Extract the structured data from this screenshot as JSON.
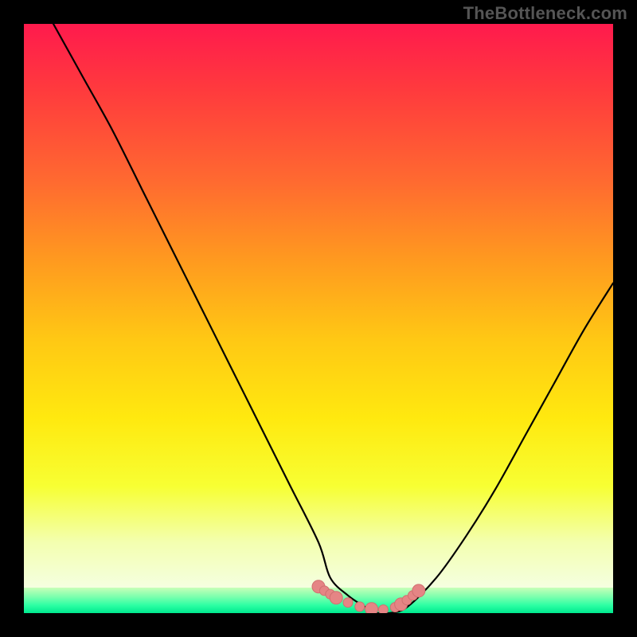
{
  "watermark": "TheBottleneck.com",
  "colors": {
    "page_bg": "#000000",
    "gradient_top": "#ff1a4d",
    "gradient_mid": "#ffe90f",
    "gradient_low": "#f5ffe0",
    "green_band_top": "#c8ffb8",
    "green_band_bottom": "#00e88e",
    "curve": "#000000",
    "marker_fill": "#e58585",
    "marker_stroke": "#d06f6f"
  },
  "chart_data": {
    "type": "line",
    "title": "",
    "xlabel": "",
    "ylabel": "",
    "xlim": [
      0,
      100
    ],
    "ylim": [
      0,
      100
    ],
    "series": [
      {
        "name": "bottleneck-curve",
        "x": [
          5,
          10,
          15,
          20,
          25,
          30,
          35,
          40,
          45,
          50,
          52,
          55,
          58,
          60,
          62,
          65,
          70,
          75,
          80,
          85,
          90,
          95,
          100
        ],
        "y": [
          100,
          91,
          82,
          72,
          62,
          52,
          42,
          32,
          22,
          12,
          6,
          3,
          1,
          0,
          0,
          1,
          6,
          13,
          21,
          30,
          39,
          48,
          56
        ]
      }
    ],
    "markers": {
      "name": "highlight-dots",
      "x": [
        50,
        51,
        52,
        53,
        55,
        57,
        59,
        61,
        63,
        64,
        65,
        66,
        67
      ],
      "y": [
        4.5,
        3.8,
        3.2,
        2.6,
        1.8,
        1.1,
        0.7,
        0.6,
        1.0,
        1.5,
        2.2,
        3.0,
        3.8
      ]
    }
  }
}
